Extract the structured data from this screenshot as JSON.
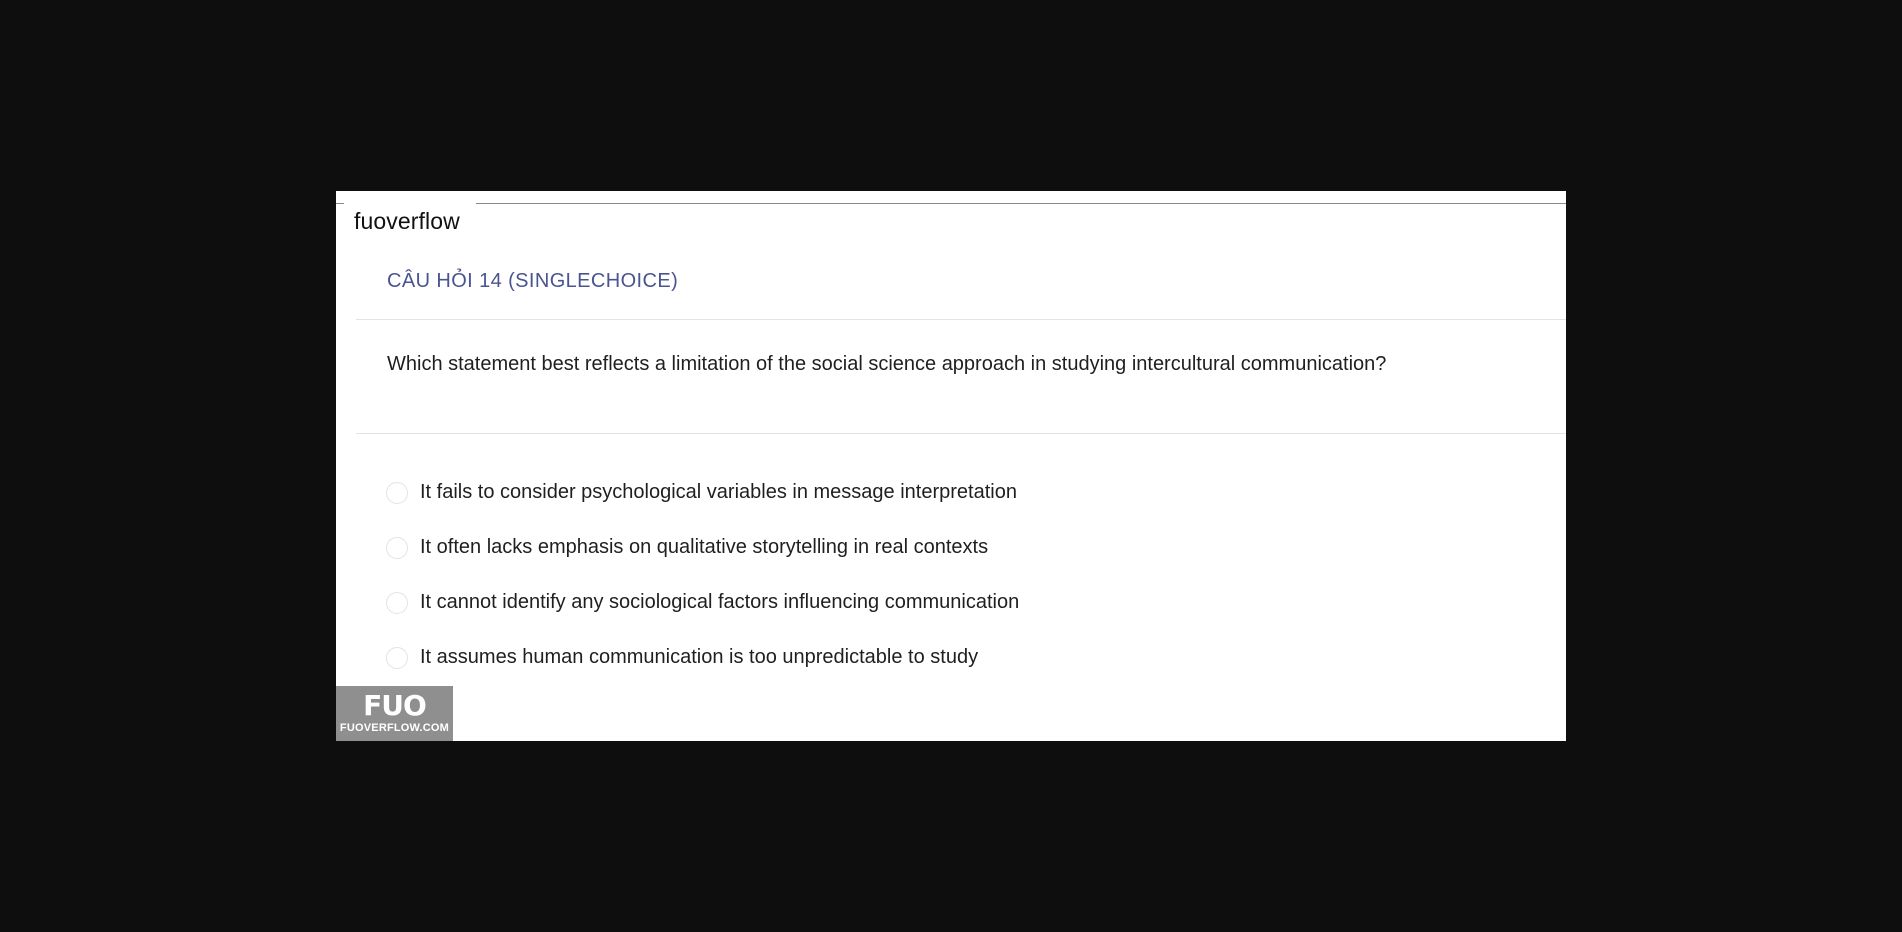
{
  "brand": "fuoverflow",
  "question": {
    "header": "CÂU HỎI 14 (SINGLECHOICE)",
    "text": "Which statement best reflects a limitation of the social science approach in studying intercultural communication?",
    "options": [
      {
        "label": "It fails to consider psychological variables in message interpretation"
      },
      {
        "label": "It often lacks emphasis on qualitative storytelling in real contexts"
      },
      {
        "label": "It cannot identify any sociological factors influencing communication"
      },
      {
        "label": "It assumes human communication is too unpredictable to study"
      }
    ]
  },
  "watermark": {
    "mark": "FUO",
    "site": "FUOVERFLOW.COM"
  },
  "colors": {
    "background": "#0e0e0e",
    "panel": "#ffffff",
    "header_accent": "#4a5490",
    "logo_bg": "#8f8f8f"
  }
}
